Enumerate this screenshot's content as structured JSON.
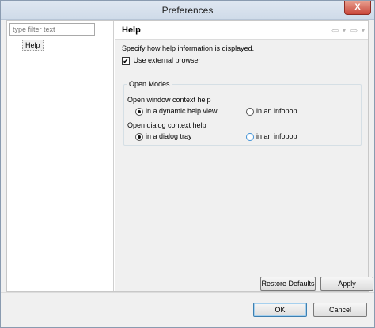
{
  "window": {
    "title": "Preferences",
    "close_label": "X"
  },
  "left": {
    "filter": {
      "placeholder": "type filter text",
      "value": "type filter text"
    },
    "tree": [
      {
        "label": "Help"
      }
    ]
  },
  "page": {
    "title": "Help",
    "nav_back": "⇦",
    "nav_back_menu": "▾",
    "nav_forward": "⇨",
    "nav_forward_menu": "▾",
    "description": "Specify how help information is displayed.",
    "use_external_browser": {
      "label": "Use external browser",
      "checked": true
    },
    "open_modes": {
      "legend": "Open Modes",
      "window_context": {
        "label": "Open window context help",
        "options": [
          {
            "label": "in a dynamic help view",
            "selected": true
          },
          {
            "label": "in an infopop",
            "selected": false
          }
        ]
      },
      "dialog_context": {
        "label": "Open dialog context help",
        "options": [
          {
            "label": "in a dialog tray",
            "selected": true
          },
          {
            "label": "in an infopop",
            "selected": false
          }
        ]
      }
    },
    "restore_defaults_label": "Restore Defaults",
    "apply_label": "Apply"
  },
  "footer": {
    "ok_label": "OK",
    "cancel_label": "Cancel"
  }
}
